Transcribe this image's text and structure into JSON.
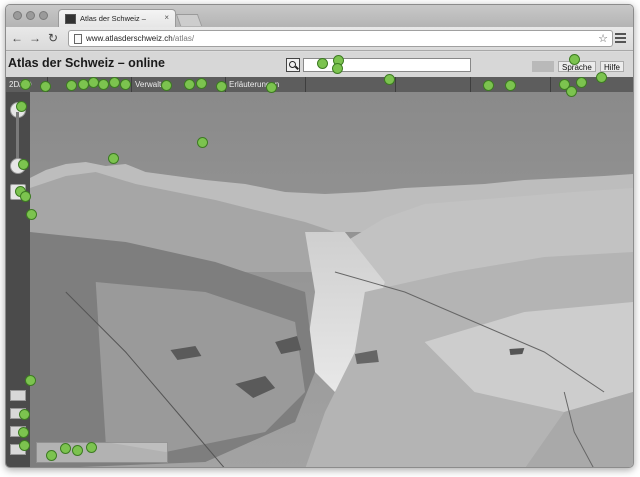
{
  "browser": {
    "tab_title": "Atlas der Schweiz –",
    "tab_close": "×",
    "url_host": "www.atlasderschweiz.ch",
    "url_path": "/atlas/",
    "back_icon": "←",
    "forward_icon": "→",
    "reload_icon": "↻",
    "star_icon": "☆"
  },
  "app": {
    "title": "Atlas der Schweiz – online",
    "search_placeholder": "",
    "buttons": {
      "language": "Sprache",
      "help": "Hilfe"
    }
  },
  "menu": [
    {
      "label": "2D/3D"
    },
    {
      "label": ""
    },
    {
      "label": "Verwalten"
    },
    {
      "label": "Erläuterungen"
    },
    {
      "label": ""
    },
    {
      "label": ""
    },
    {
      "label": ""
    },
    {
      "label": ""
    },
    {
      "label": ""
    }
  ],
  "colors": {
    "sky": "#8d8d8d",
    "menubar": "#5d5d5d",
    "sidebar": "#4b4b4b",
    "marker": "#7cc34f"
  },
  "icons": [
    "pan-icon",
    "zoom-in-icon",
    "zoom-slider-icon",
    "compass-icon",
    "layer-icon",
    "search-icon",
    "star-icon",
    "wrench-icon"
  ]
}
